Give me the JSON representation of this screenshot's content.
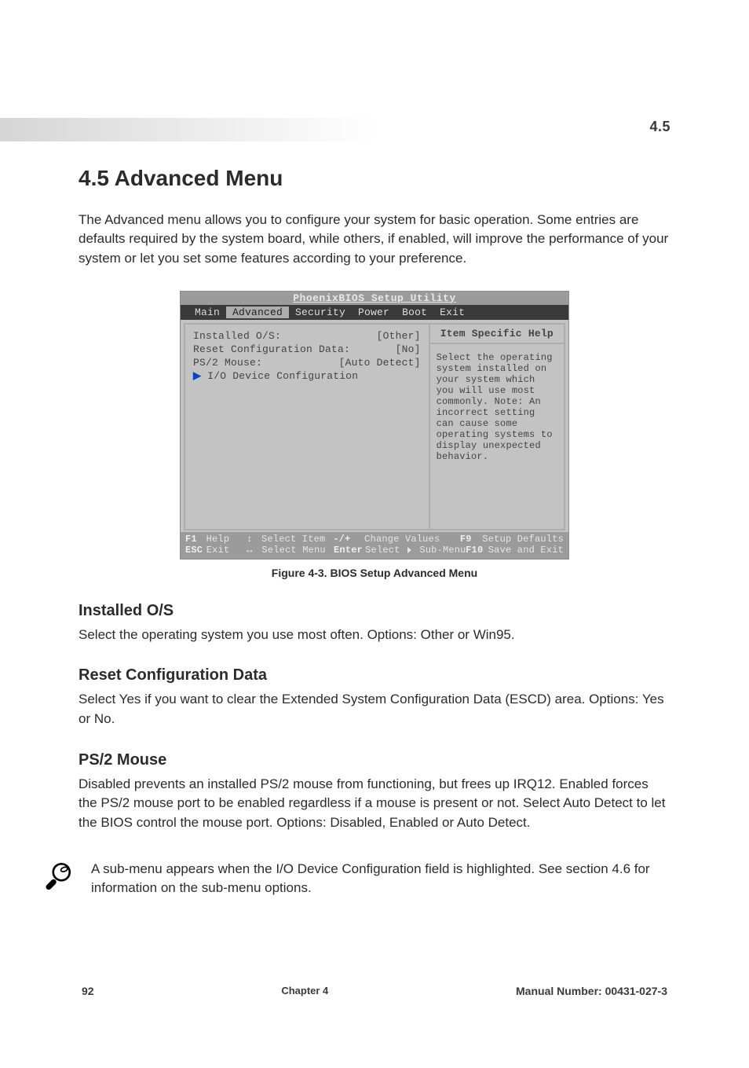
{
  "header": {
    "section_number": "4.5",
    "heading": "4.5  Advanced Menu",
    "intro": "The Advanced menu allows you to configure your system for basic operation. Some entries are defaults required by the system board, while others, if enabled, will improve the performance of your system or let you set some features according to your preference."
  },
  "bios": {
    "title": "PhoenixBIOS Setup Utility",
    "tabs": [
      "Main",
      "Advanced",
      "Security",
      "Power",
      "Boot",
      "Exit"
    ],
    "selected_tab_index": 1,
    "left_rows": [
      {
        "label": "Installed O/S:",
        "value": "[Other]"
      },
      {
        "label": "Reset Configuration Data:",
        "value": "[No]"
      },
      {
        "label": "PS/2 Mouse:",
        "value": "[Auto Detect]"
      },
      {
        "label": "▶ I/O Device Configuration",
        "value": "",
        "submenu": true
      }
    ],
    "right_header": "Item Specific Help",
    "right_help": "Select the operating system installed on your system which you will use most commonly.\n\nNote: An incorrect setting can cause some operating systems to display unexpected behavior.",
    "footer": {
      "line1": [
        {
          "k": "F1",
          "t": "Help"
        },
        {
          "k": "↕",
          "t": "Select Item"
        },
        {
          "k": "-/+",
          "t": "Change Values"
        },
        {
          "k": "F9",
          "t": "Setup Defaults"
        }
      ],
      "line2": [
        {
          "k": "ESC",
          "t": "Exit"
        },
        {
          "k": "↔",
          "t": "Select Menu"
        },
        {
          "k": "Enter",
          "t": "Select ▶ Sub-Menu"
        },
        {
          "k": "F10",
          "t": "Save and Exit"
        }
      ]
    }
  },
  "caption": "Figure 4-3.  BIOS Setup Advanced Menu",
  "options": [
    {
      "name": "Installed O/S",
      "desc": "Select the operating system you use most often. Options: Other or Win95."
    },
    {
      "name": "Reset Configuration Data",
      "desc": "Select Yes if you want to clear the Extended System Configuration Data (ESCD) area. Options: Yes or No."
    },
    {
      "name": "PS/2 Mouse",
      "desc": "Disabled prevents an installed PS/2 mouse from functioning, but frees up IRQ12. Enabled forces the PS/2 mouse port to be enabled regardless if a mouse is present or not. Select Auto Detect to let the BIOS control the mouse port. Options: Disabled, Enabled or Auto Detect."
    }
  ],
  "note": "A sub-menu appears when the I/O Device Configuration field is highlighted. See section 4.6 for information on the sub-menu options.",
  "footerpg": {
    "left": "92",
    "center": "Chapter 4",
    "right": "Manual Number: 00431-027-3"
  }
}
